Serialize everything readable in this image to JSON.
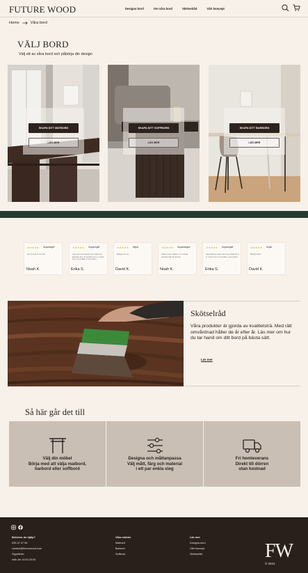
{
  "header": {
    "logo": "FUTURE WOOD",
    "nav": [
      "Designa bord",
      "Om våra bord",
      "Skötselråd",
      "Vårt koncept"
    ],
    "icons": [
      "search-icon",
      "cart-icon"
    ]
  },
  "breadcrumb": {
    "home": "Home",
    "current": "Våra bord"
  },
  "hero": {
    "title": "VÄLJ BORD",
    "subtitle": "Välj ett av våra bord och påbörja din design"
  },
  "cards": [
    {
      "primary": "SKAPA DITT MATBORD",
      "secondary": "LÄS MER"
    },
    {
      "primary": "SKAPA DITT SOFFBORD",
      "secondary": "LÄS MER"
    },
    {
      "primary": "SKAPA DITT BARBORD",
      "secondary": "LÄS MER"
    }
  ],
  "reviews": [
    {
      "stars": "★★★★★",
      "rating": "Superbjöf",
      "text": "Her Gurnd st ocundll",
      "name": "Noah K."
    },
    {
      "stars": "★★★★★",
      "rating": "Supersjäf",
      "text": "Jag rekommenderar bal önskat fär klarstan dem af perfekt bum in ochen förs runt kvällen med ettden",
      "name": "Erika S."
    },
    {
      "stars": "★★★★★",
      "rating": "Mjuit",
      "text": "Bärlgli och Ion",
      "name": "David K."
    },
    {
      "stars": "★★★★★",
      "rating": "Supernbjuf",
      "text": "Alldeur lunet affden, bor fantda uiänthig fdel lar Knolia",
      "name": "Noah K."
    },
    {
      "stars": "★★★★★",
      "rating": "Supersjäf",
      "text": "Jag alldeelen djun dem af perfekt bum in ochen förs runt kvällen med ettden",
      "name": "Erika S."
    },
    {
      "stars": "★★★★★",
      "rating": "Kojik",
      "text": "Bärlgli Iaforri",
      "name": "David K."
    }
  ],
  "care": {
    "title": "Skötselråd",
    "text": "Våra produkter är gjorda av kvalitetsträ. Med rätt omvårdnad håller de år efter år. Läs mer om hur du tar hand om ditt bord på bästa sätt.",
    "link": "Läs mer"
  },
  "how": {
    "title": "Så här går det till",
    "steps": [
      {
        "icon": "table-icon",
        "lines": [
          "Välj din möbel",
          "Börja med att välja matbord,",
          "barbord eller soffbord"
        ]
      },
      {
        "icon": "sliders-icon",
        "lines": [
          "Designa och måttanpassa",
          "Välj mått, färg och material",
          "i ett par enkla steg"
        ]
      },
      {
        "icon": "truck-icon",
        "lines": [
          "Fri hemleverans",
          "Direkt till dörren",
          "utan kostnad"
        ]
      }
    ]
  },
  "footer": {
    "social": [
      "instagram-icon",
      "facebook-icon"
    ],
    "col1": {
      "heading": "Behöver du hjälp?",
      "lines": [
        "039-47 47 98",
        "contact@futurewood.com",
        "Öppettider",
        "mån-fre 10:00-20:00"
      ]
    },
    "col2": {
      "heading": "Våra möbler",
      "lines": [
        "Matbord",
        "Barbord",
        "Soffbord"
      ]
    },
    "col3": {
      "heading": "Läs mer",
      "lines": [
        "Designa bord",
        "Vårt koncept",
        "Skötselråd"
      ]
    },
    "brand": "FW",
    "copyright": "© 2024"
  },
  "colors": {
    "background": "#f7f1ea",
    "dark": "#2a201b",
    "band": "#263a31",
    "step": "#c9bfb4"
  }
}
